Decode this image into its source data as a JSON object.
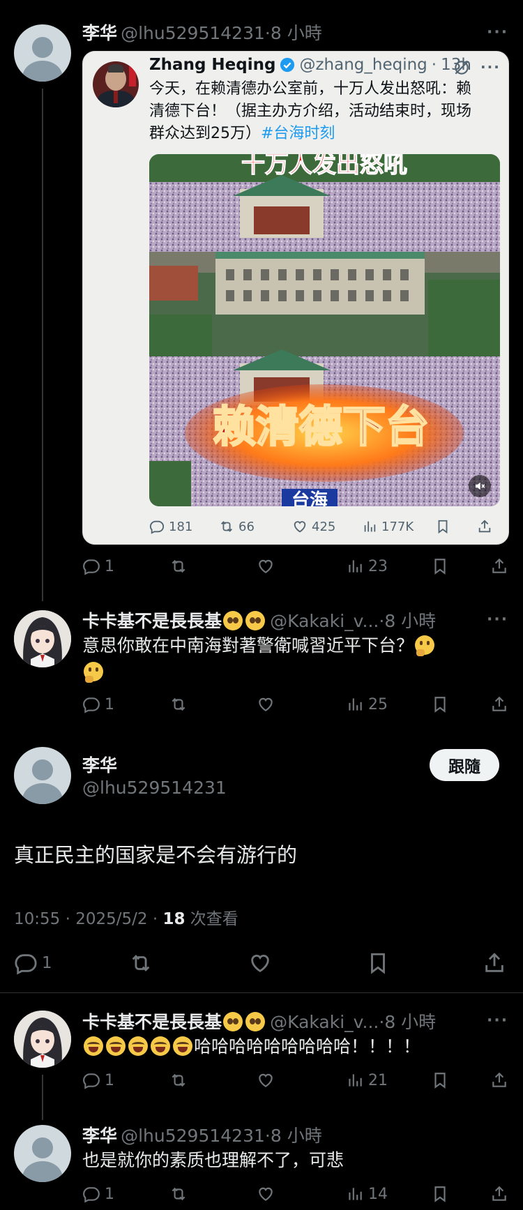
{
  "tweet1": {
    "author": "李华",
    "handle": "@lhu529514231",
    "sep": "·",
    "time": "8 小時",
    "more": "···",
    "quote": {
      "author": "Zhang Heqing",
      "handle": "@zhang_heqing",
      "sep": "·",
      "time": "13h",
      "more": "···",
      "text_line1": "今天，在赖清德办公室前，十万人发出怒吼：赖",
      "text_line2": "清德下台！（据主办方介绍，活动结束时，现场",
      "text_line3": "群众达到25万）",
      "hashtag": "#台海时刻",
      "video_caption_top": "十万人发出怒吼",
      "video_caption_main": "赖清德下台",
      "video_caption_bottom": "台海",
      "stats": {
        "replies": "181",
        "reposts": "66",
        "likes": "425",
        "views": "177K"
      }
    },
    "stats": {
      "replies": "1",
      "reposts": "",
      "likes": "",
      "views": "23"
    }
  },
  "reply1": {
    "author": "卡卡基不是長長基",
    "handle": "@Kakaki_v...",
    "sep": "·",
    "time": "8 小時",
    "more": "···",
    "text": "意思你敢在中南海對著警衛喊習近平下台？",
    "stats": {
      "replies": "1",
      "reposts": "",
      "likes": "",
      "views": "25"
    }
  },
  "main": {
    "author": "李华",
    "handle": "@lhu529514231",
    "follow_label": "跟隨",
    "text": "真正民主的国家是不会有游行的",
    "timestamp": "10:55 · 2025/5/2 · ",
    "views_count": "18",
    "views_label": " 次查看",
    "stats": {
      "replies": "1"
    }
  },
  "reply2": {
    "author": "卡卡基不是長長基",
    "handle": "@Kakaki_v...",
    "sep": "·",
    "time": "8 小時",
    "more": "···",
    "text": "哈哈哈哈哈哈哈哈哈！！！！",
    "stats": {
      "replies": "1",
      "reposts": "",
      "likes": "",
      "views": "21"
    }
  },
  "reply3": {
    "author": "李华",
    "handle": "@lhu529514231",
    "sep": "·",
    "time": "8 小時",
    "text": "也是就你的素质也理解不了，可悲",
    "stats": {
      "replies": "1",
      "reposts": "",
      "likes": "",
      "views": "14"
    }
  },
  "colors": {
    "background": "#000000",
    "text": "#e7e9ea",
    "muted": "#71767b",
    "link": "#1d9bf0",
    "verified": "#1d9bf0",
    "card": "#efefed"
  }
}
